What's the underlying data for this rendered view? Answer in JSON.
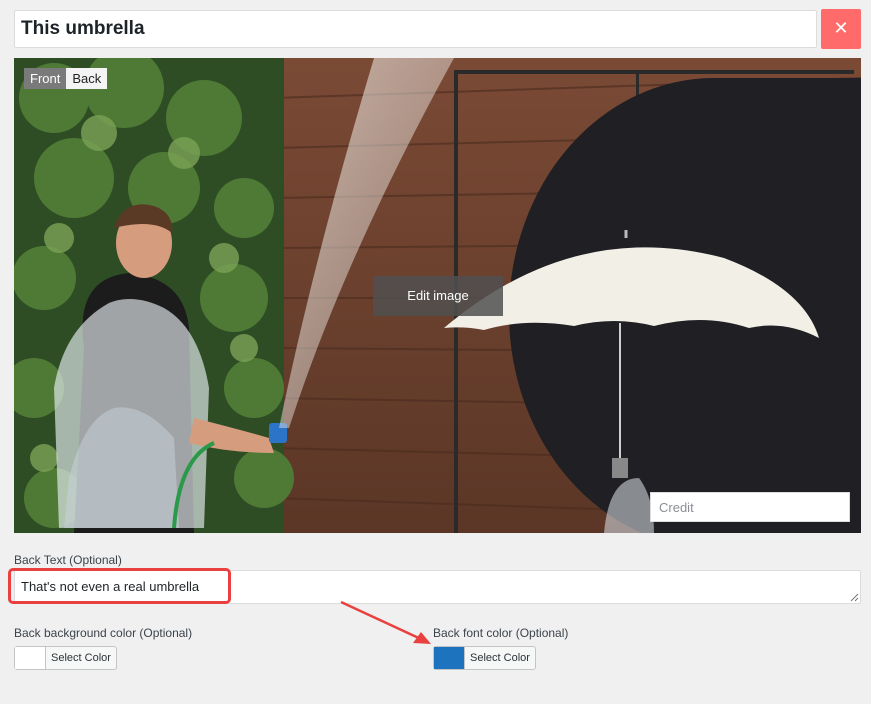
{
  "card": {
    "title": "This umbrella",
    "close_symbol": "✕"
  },
  "image": {
    "face_front_label": "Front",
    "face_back_label": "Back",
    "edit_label": "Edit image",
    "credit_placeholder": "Credit"
  },
  "back_text": {
    "label": "Back Text (Optional)",
    "value": "That's not even a real umbrella"
  },
  "back_bg_color": {
    "label": "Back background color (Optional)",
    "button_label": "Select Color",
    "swatch": "#ffffff"
  },
  "back_font_color": {
    "label": "Back font color (Optional)",
    "button_label": "Select Color",
    "swatch": "#1e73be"
  },
  "colors": {
    "close_button": "#ff6b6b",
    "annotation": "#e8413f"
  }
}
